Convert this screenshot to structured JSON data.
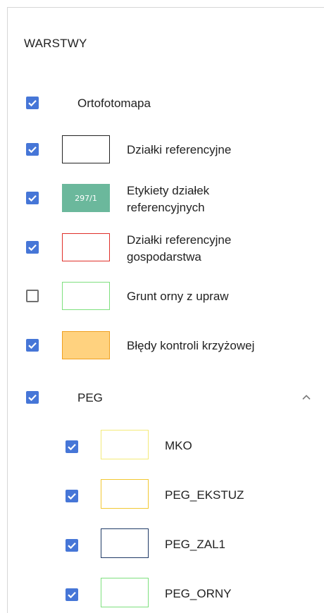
{
  "panel": {
    "title": "WARSTWY"
  },
  "layers": [
    {
      "id": "ortofotomapa",
      "label": "Ortofotomapa",
      "checked": true,
      "swatch": null
    },
    {
      "id": "dzialki-referencyjne",
      "label": "Działki referencyjne",
      "checked": true,
      "swatch": {
        "fill": "#ffffff",
        "border": "#222222",
        "text": ""
      }
    },
    {
      "id": "etykiety",
      "label": "Etykiety działek referencyjnych",
      "label_line1": "Etykiety działek",
      "label_line2": "referencyjnych",
      "checked": true,
      "swatch": {
        "fill": "#6bb89c",
        "border": "#6bb89c",
        "text": "297/1"
      }
    },
    {
      "id": "dzialki-gospodarstwa",
      "label": "Działki referencyjne gospodarstwa",
      "label_line1": "Działki referencyjne",
      "label_line2": "gospodarstwa",
      "checked": true,
      "swatch": {
        "fill": "#ffffff",
        "border": "#e0302a",
        "text": ""
      }
    },
    {
      "id": "grunt-orny",
      "label": "Grunt orny z upraw",
      "checked": false,
      "swatch": {
        "fill": "#ffffff",
        "border": "#7ee07e",
        "text": ""
      }
    },
    {
      "id": "bledy-kontroli",
      "label": "Błędy kontroli krzyżowej",
      "checked": true,
      "swatch": {
        "fill": "#ffd27f",
        "border": "#f0a020",
        "text": ""
      }
    }
  ],
  "peg_group": {
    "label": "PEG",
    "checked": true,
    "expanded": true,
    "children": [
      {
        "id": "mko",
        "label": "MKO",
        "checked": true,
        "swatch": {
          "fill": "#ffffff",
          "border": "#f3ea7a"
        }
      },
      {
        "id": "peg-ekstuz",
        "label": "PEG_EKSTUZ",
        "checked": true,
        "swatch": {
          "fill": "#ffffff",
          "border": "#f2c832"
        }
      },
      {
        "id": "peg-zal1",
        "label": "PEG_ZAL1",
        "checked": true,
        "swatch": {
          "fill": "#ffffff",
          "border": "#1f3a66"
        }
      },
      {
        "id": "peg-orny",
        "label": "PEG_ORNY",
        "checked": true,
        "swatch": {
          "fill": "#ffffff",
          "border": "#7ee07e"
        }
      }
    ]
  },
  "colors": {
    "checkbox_checked": "#4676d7",
    "checkbox_unchecked_border": "#707070"
  }
}
